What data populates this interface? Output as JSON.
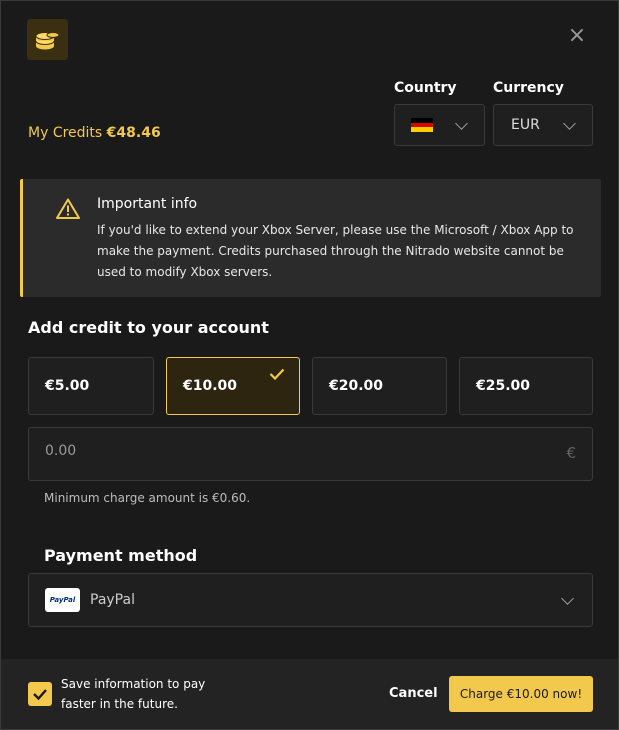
{
  "header": {
    "coins_icon": "coins-icon",
    "close_icon": "close-icon"
  },
  "credits": {
    "label": "My Credits",
    "amount": "€48.46"
  },
  "country": {
    "label": "Country",
    "flag": "Germany flag"
  },
  "currency": {
    "label": "Currency",
    "value": "EUR"
  },
  "info": {
    "title": "Important info",
    "text": "If you'd like to extend your Xbox Server, please use the Microsoft / Xbox App to make the payment. Credits purchased through the Nitrado website cannot be used to modify Xbox servers."
  },
  "add_credit": {
    "title": "Add credit to your account",
    "amounts": [
      {
        "label": "€5.00",
        "selected": false
      },
      {
        "label": "€10.00",
        "selected": true
      },
      {
        "label": "€20.00",
        "selected": false
      },
      {
        "label": "€25.00",
        "selected": false
      }
    ],
    "custom_placeholder": "0.00",
    "currency_symbol": "€",
    "min_note": "Minimum charge amount is €0.60."
  },
  "payment": {
    "title": "Payment method",
    "method": "PayPal",
    "logo_text": "PayPal"
  },
  "footer": {
    "save_text": "Save information to pay faster in the future.",
    "save_checked": true,
    "cancel_label": "Cancel",
    "charge_label": "Charge €10.00 now!"
  },
  "colors": {
    "accent": "#f2c94c",
    "background": "#1a1a1a"
  }
}
